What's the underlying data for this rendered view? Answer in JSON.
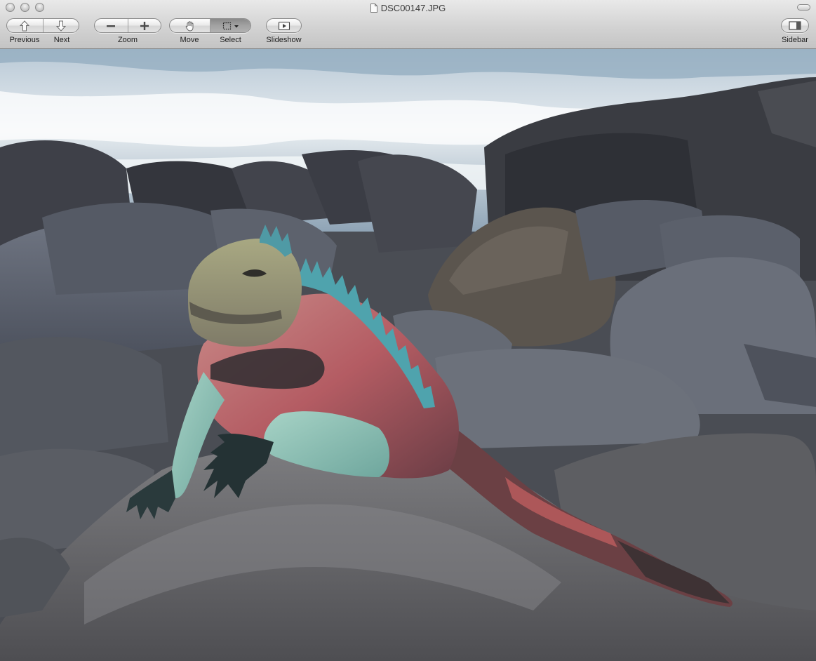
{
  "window": {
    "title": "DSC00147.JPG"
  },
  "toolbar": {
    "previous_label": "Previous",
    "next_label": "Next",
    "zoom_label": "Zoom",
    "move_label": "Move",
    "select_label": "Select",
    "slideshow_label": "Slideshow",
    "sidebar_label": "Sidebar",
    "active_tool": "select"
  },
  "icons": {
    "previous": "arrow-up-icon",
    "next": "arrow-down-icon",
    "zoom_out": "minus-icon",
    "zoom_in": "plus-icon",
    "move": "hand-icon",
    "select": "marquee-select-icon",
    "slideshow": "play-slideshow-icon",
    "sidebar": "sidebar-icon",
    "document": "document-icon"
  },
  "image": {
    "subject": "marine iguana on volcanic rocks with surf in background"
  }
}
